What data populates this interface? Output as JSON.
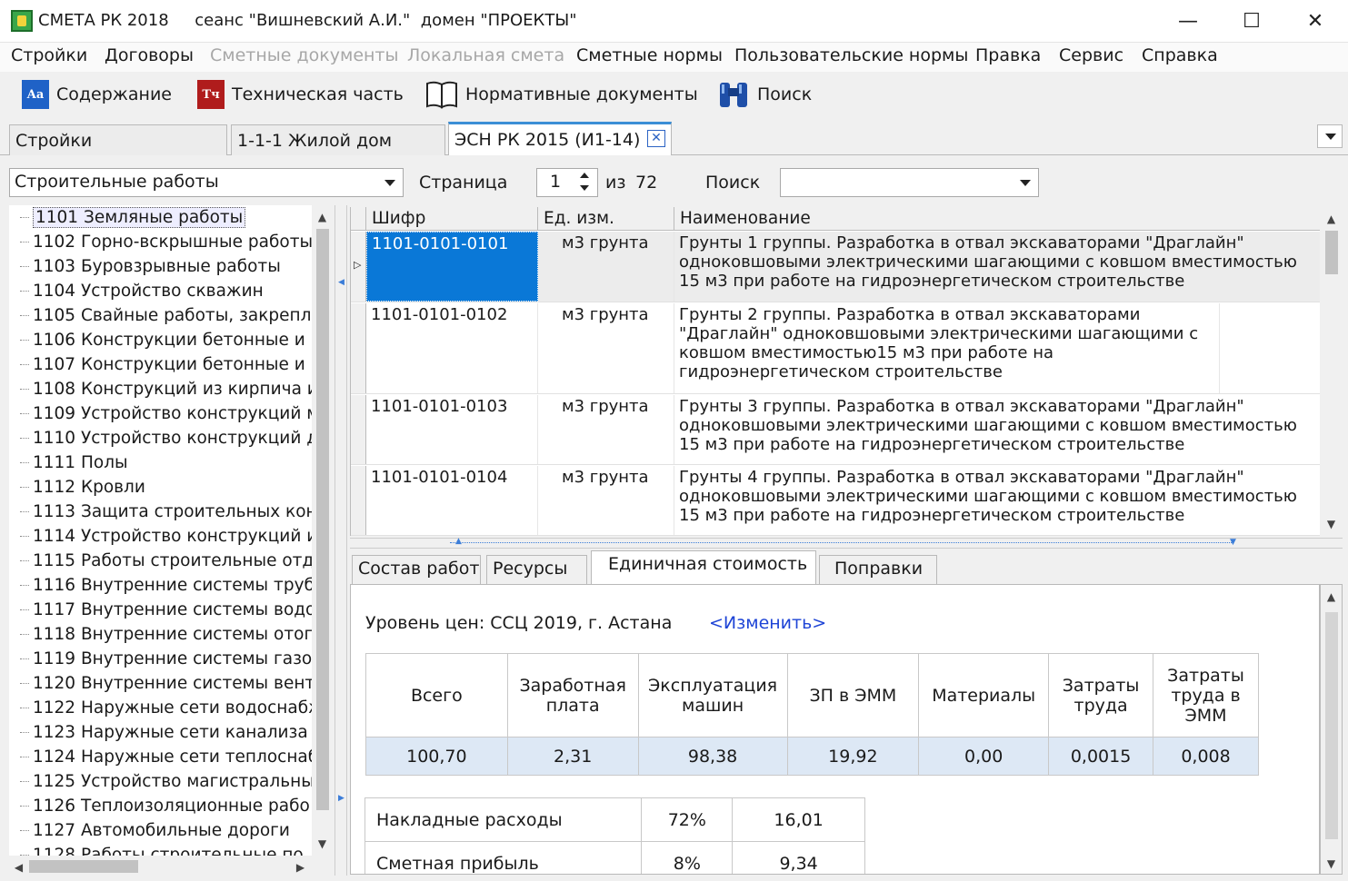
{
  "window": {
    "title": "СМЕТА РК 2018     сеанс \"Вишневский А.И.\"  домен \"ПРОЕКТЫ\"",
    "minimize": "—",
    "maximize": "☐",
    "close": "✕"
  },
  "menu": [
    {
      "label": "Стройки",
      "enabled": true
    },
    {
      "label": "Договоры",
      "enabled": true
    },
    {
      "label": "Сметные документы",
      "enabled": false
    },
    {
      "label": "Локальная смета",
      "enabled": false
    },
    {
      "label": "Сметные нормы",
      "enabled": true
    },
    {
      "label": "Пользовательские нормы",
      "enabled": true
    },
    {
      "label": "Правка",
      "enabled": true
    },
    {
      "label": "Сервис",
      "enabled": true
    },
    {
      "label": "Справка",
      "enabled": true
    }
  ],
  "toolbar": {
    "contents": {
      "label": "Содержание",
      "icon": "contents-icon",
      "glyph": "Aa",
      "color": "#1f62c7"
    },
    "technical": {
      "label": "Техническая часть",
      "icon": "technical-part-icon",
      "glyph": "Тч",
      "color": "#b01c1c"
    },
    "docs": {
      "label": "Нормативные документы",
      "icon": "book-icon"
    },
    "search": {
      "label": "Поиск",
      "icon": "binoculars-icon"
    }
  },
  "tabs": [
    {
      "label": "Стройки"
    },
    {
      "label": "1-1-1 Жилой дом"
    },
    {
      "label": "ЭСН РК 2015 (И1-14)",
      "active": true
    }
  ],
  "filter": {
    "section": "Строительные работы",
    "page_label": "Страница",
    "page": "1",
    "of_label": "из",
    "total_pages": "72",
    "search_label": "Поиск",
    "search_value": ""
  },
  "tree": [
    "1101 Земляные работы",
    "1102 Горно-вскрышные работы",
    "1103 Буровзрывные работы",
    "1104 Устройство скважин",
    "1105 Свайные работы, закрепл",
    "1106 Конструкции бетонные и :",
    "1107 Конструкции бетонные и :",
    "1108 Конструкций из кирпича и",
    "1109 Устройство конструкций м",
    "1110 Устройство конструкций д",
    "1111 Полы",
    "1112 Кровли",
    "1113 Защита строительных кон",
    "1114 Устройство  конструкций и",
    "1115 Работы строительные отд",
    "1116 Внутренние системы труб",
    "1117 Внутренние системы водо",
    "1118 Внутренние системы отоп",
    "1119 Внутренние системы газо(",
    "1120 Внутренние системы вент",
    "1122 Наружные сети водоснабж",
    "1123 Наружные сети  канализа",
    "1124 Наружные сети теплоснаб",
    "1125 Устройство магистральны:",
    "1126 Теплоизоляционные рабо",
    "1127 Автомобильные дороги",
    "1128 Работы строительные по"
  ],
  "grid": {
    "headers": {
      "code": "Шифр",
      "unit": "Ед. изм.",
      "name": "Наименование"
    },
    "rows": [
      {
        "code": "1101-0101-0101",
        "unit": "м3 грунта",
        "name": "Грунты 1 группы. Разработка в отвал экскаваторами \"Драглайн\" одноковшовыми электрическими шагающими с ковшом вместимостью 15 м3 при работе на гидроэнергетическом строительстве"
      },
      {
        "code": "1101-0101-0102",
        "unit": "м3 грунта",
        "name": "Грунты 2 группы. Разработка в отвал экскаваторами \"Драглайн\" одноковшовыми электрическими шагающими с ковшом вместимостью15 м3 при работе на гидроэнергетическом строительстве"
      },
      {
        "code": "1101-0101-0103",
        "unit": "м3 грунта",
        "name": "Грунты 3 группы. Разработка в отвал экскаваторами \"Драглайн\" одноковшовыми электрическими шагающими с ковшом вместимостью 15 м3 при работе на гидроэнергетическом строительстве"
      },
      {
        "code": "1101-0101-0104",
        "unit": "м3 грунта",
        "name": "Грунты 4 группы. Разработка в отвал экскаваторами \"Драглайн\" одноковшовыми электрическими шагающими с ковшом вместимостью 15 м3 при работе на гидроэнергетическом строительстве"
      }
    ]
  },
  "detail_tabs": [
    {
      "label": "Состав работ"
    },
    {
      "label": "Ресурсы"
    },
    {
      "label": "Единичная стоимость",
      "active": true
    },
    {
      "label": "Поправки"
    }
  ],
  "detail": {
    "price_level": "Уровень цен: ССЦ 2019, г. Астана",
    "change_link": "<Изменить>",
    "cost_headers": [
      "Всего",
      "Заработная плата",
      "Эксплуатация машин",
      "ЗП в ЭММ",
      "Материалы",
      "Затраты труда",
      "Затраты труда в ЭММ"
    ],
    "cost_values": [
      "100,70",
      "2,31",
      "98,38",
      "19,92",
      "0,00",
      "0,0015",
      "0,008"
    ],
    "overhead": {
      "label": "Накладные расходы",
      "percent": "72%",
      "value": "16,01"
    },
    "profit": {
      "label": "Сметная прибыль",
      "percent": "8%",
      "value": "9,34"
    }
  }
}
